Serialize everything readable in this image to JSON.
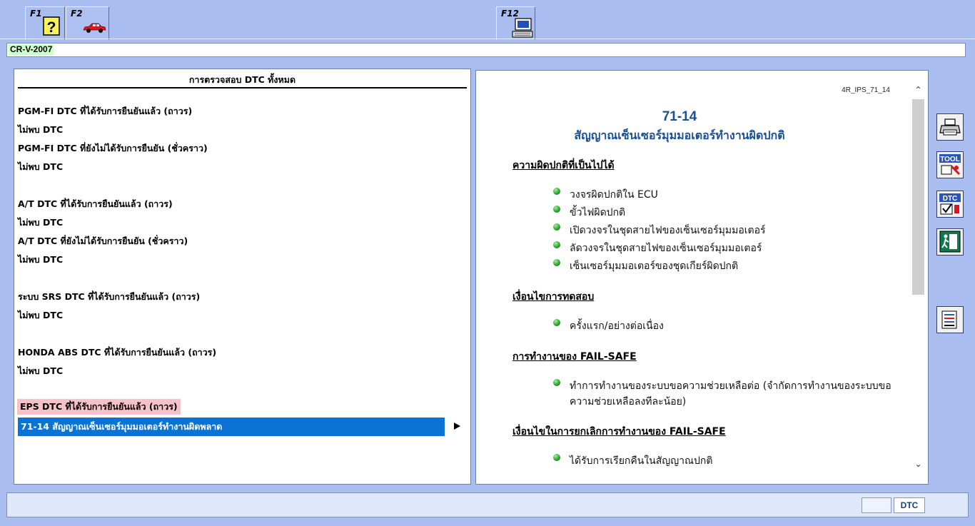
{
  "toolbar": {
    "f1_label": "F1",
    "f2_label": "F2",
    "f12_label": "F12"
  },
  "model": "CR-V-2007",
  "left": {
    "header": "การตรวจสอบ DTC ทั้งหมด",
    "lines": [
      "PGM-FI DTC ที่ได้รับการยืนยันแล้ว (ถาวร)",
      "ไม่พบ DTC",
      "PGM-FI DTC ที่ยังไม่ได้รับการยืนยัน (ชั่วคราว)",
      "ไม่พบ DTC",
      "A/T DTC ที่ได้รับการยืนยันแล้ว (ถาวร)",
      "ไม่พบ DTC",
      "A/T DTC ที่ยังไม่ได้รับการยืนยัน (ชั่วคราว)",
      "ไม่พบ DTC",
      "ระบบ SRS DTC ที่ได้รับการยืนยันแล้ว (ถาวร)",
      "ไม่พบ DTC",
      "HONDA ABS DTC ที่ได้รับการยืนยันแล้ว (ถาวร)",
      "ไม่พบ DTC"
    ],
    "eps_heading": "EPS DTC ที่ได้รับการยืนยันแล้ว (ถาวร)",
    "selected": "71-14 สัญญาณเซ็นเซอร์มุมมอเตอร์ทำงานผิดพลาด"
  },
  "doc": {
    "code": "4R_IPS_71_14",
    "number": "71-14",
    "title": "สัญญาณเซ็นเซอร์มุมมอเตอร์ทำงานผิดปกติ",
    "sections": [
      {
        "heading": "ความผิดปกติที่เป็นไปได้",
        "items": [
          "วงจรผิดปกติใน ECU",
          "ขั้วไฟผิดปกติ",
          "เปิดวงจรในชุดสายไฟของเซ็นเซอร์มุมมอเตอร์",
          "ลัดวงจรในชุดสายไฟของเซ็นเซอร์มุมมอเตอร์",
          "เซ็นเซอร์มุมมอเตอร์ของชุดเกียร์ผิดปกติ"
        ]
      },
      {
        "heading": "เงื่อนไขการทดสอบ",
        "items": [
          "ครั้งแรก/อย่างต่อเนื่อง"
        ]
      },
      {
        "heading": "การทำงานของ FAIL-SAFE",
        "items": [
          "ทำการทำงานของระบบขอความช่วยเหลือต่อ (จำกัดการทำงานของระบบขอ",
          "ความช่วยเหลือลงทีละน้อย)"
        ]
      },
      {
        "heading": "เงื่อนไขในการยกเลิกการทำงานของ FAIL-SAFE",
        "items": [
          "ได้รับการเรียกคืนในสัญญาณปกติ"
        ]
      }
    ]
  },
  "status": {
    "mode": "DTC"
  },
  "colors": {
    "selection": "#0b73d4",
    "eps_highlight": "#f5c2cc",
    "doc_title": "#1a4f95",
    "background": "#a9bdf0"
  }
}
